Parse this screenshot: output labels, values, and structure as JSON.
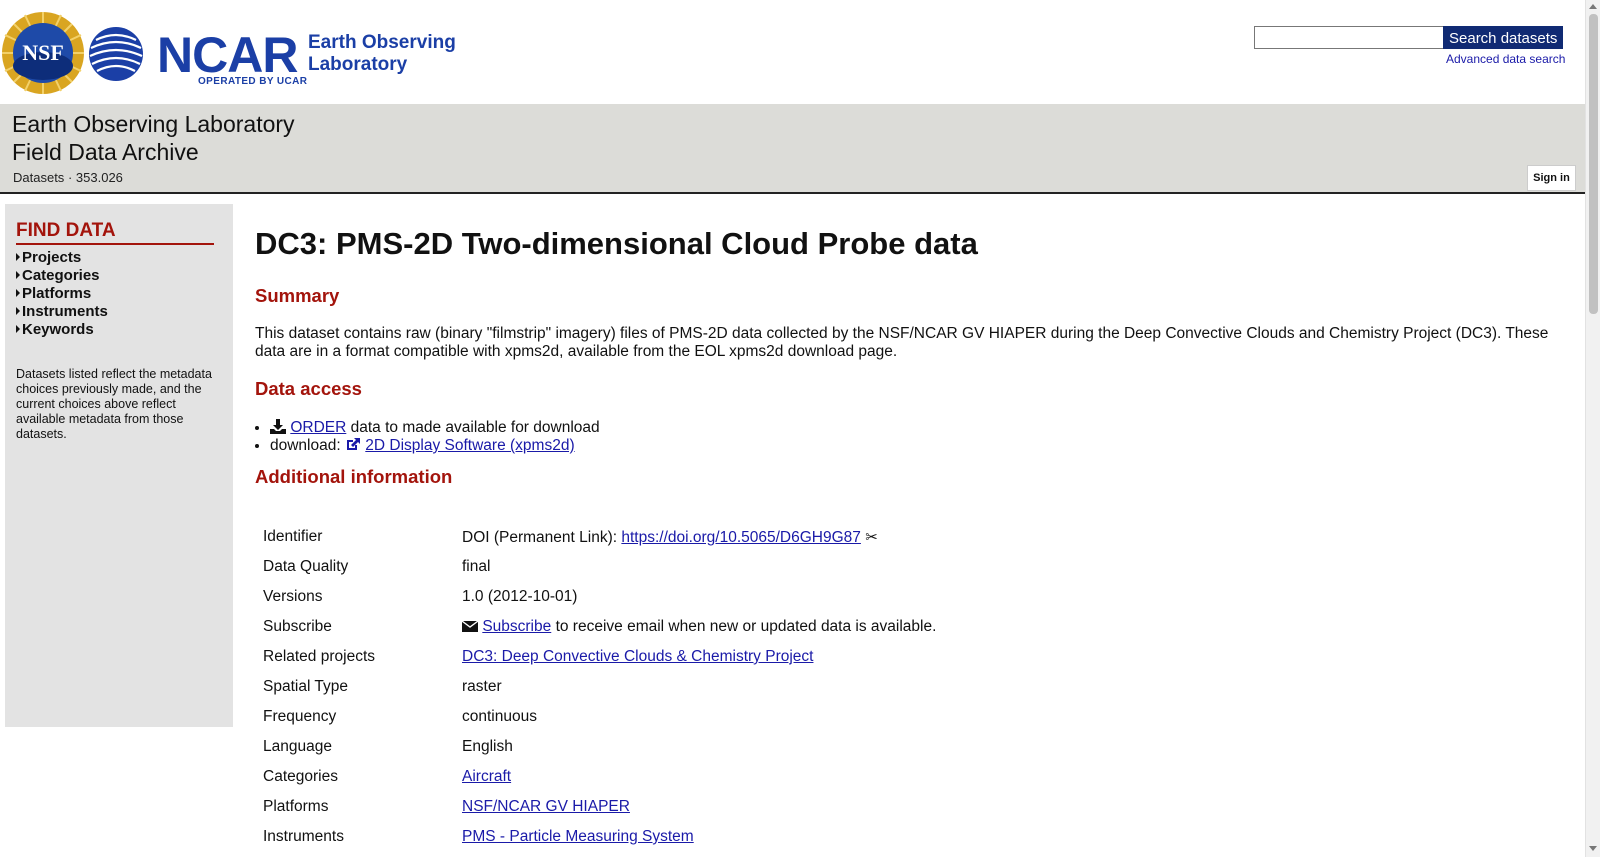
{
  "header": {
    "nsf_seal_text": "NSF",
    "ncar_word": "NCAR",
    "ncar_operated": "OPERATED BY UCAR",
    "eol_line1": "Earth Observing",
    "eol_line2": "Laboratory",
    "search_placeholder": "",
    "search_button": "Search datasets",
    "advanced_search": "Advanced data search"
  },
  "banner": {
    "title_line1": "Earth Observing Laboratory",
    "title_line2": "Field Data Archive",
    "breadcrumb": [
      "Datasets",
      "353.026"
    ],
    "breadcrumb_sep": "·",
    "sign_in": "Sign in"
  },
  "sidebar": {
    "title": "FIND DATA",
    "facets": [
      "Projects",
      "Categories",
      "Platforms",
      "Instruments",
      "Keywords"
    ],
    "note": "Datasets listed reflect the metadata choices previously made, and the current choices above reflect available metadata from those datasets."
  },
  "main": {
    "title": "DC3: PMS-2D Two-dimensional Cloud Probe data",
    "summary_heading": "Summary",
    "summary_text": "This dataset contains raw (binary \"filmstrip\" imagery) files of PMS-2D data collected by the NSF/NCAR GV HIAPER during the Deep Convective Clouds and Chemistry Project (DC3). These data are in a format compatible with xpms2d, available from the EOL xpms2d download page.",
    "access_heading": "Data access",
    "access": {
      "order_link": "ORDER",
      "order_rest": "data to made available for download",
      "download_label": "download:",
      "download_link": "2D Display Software (xpms2d)"
    },
    "additional_heading": "Additional information",
    "info": {
      "identifier_key": "Identifier",
      "identifier_prefix": "DOI (Permanent Link):",
      "identifier_link": "https://doi.org/10.5065/D6GH9G87",
      "quality_key": "Data Quality",
      "quality_val": "final",
      "versions_key": "Versions",
      "versions_val": "1.0 (2012-10-01)",
      "subscribe_key": "Subscribe",
      "subscribe_link": "Subscribe",
      "subscribe_rest": "to receive email when new or updated data is available.",
      "related_key": "Related projects",
      "related_val": "DC3: Deep Convective Clouds & Chemistry Project",
      "spatial_key": "Spatial Type",
      "spatial_val": "raster",
      "frequency_key": "Frequency",
      "frequency_val": "continuous",
      "language_key": "Language",
      "language_val": "English",
      "categories_key": "Categories",
      "categories_val": "Aircraft",
      "platforms_key": "Platforms",
      "platforms_val": "NSF/NCAR GV HIAPER",
      "instruments_key": "Instruments",
      "instruments_val": "PMS - Particle Measuring System"
    }
  }
}
